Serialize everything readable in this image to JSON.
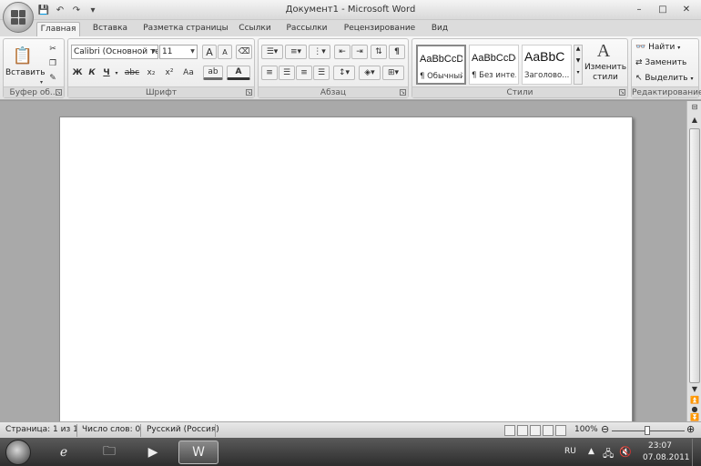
{
  "window": {
    "title": "Документ1 - Microsoft Word",
    "controls": {
      "minimize": "–",
      "maximize": "□",
      "close": "✕"
    }
  },
  "quick_access": {
    "save_icon": "floppy-icon",
    "undo_icon": "undo-icon",
    "redo_icon": "redo-icon"
  },
  "tabs": [
    {
      "label": "Главная",
      "active": true
    },
    {
      "label": "Вставка"
    },
    {
      "label": "Разметка страницы"
    },
    {
      "label": "Ссылки"
    },
    {
      "label": "Рассылки"
    },
    {
      "label": "Рецензирование"
    },
    {
      "label": "Вид"
    }
  ],
  "ribbon": {
    "clipboard": {
      "label": "Буфер об...",
      "paste_label": "Вставить"
    },
    "font": {
      "label": "Шрифт",
      "font_name": "Calibri (Основной те",
      "font_size": "11",
      "grow": "A",
      "shrink": "A",
      "bold": "Ж",
      "italic": "К",
      "underline": "Ч",
      "strike": "abc",
      "subscript": "x₂",
      "superscript": "x²",
      "change_case": "Aa",
      "highlight": "ab",
      "font_color": "A"
    },
    "paragraph": {
      "label": "Абзац",
      "pilcrow": "¶"
    },
    "styles": {
      "label": "Стили",
      "items": [
        {
          "sample": "AaBbCcDc",
          "name": "¶ Обычный"
        },
        {
          "sample": "AaBbCcDc",
          "name": "¶ Без инте..."
        },
        {
          "sample": "AaBbC",
          "name": "Заголово..."
        }
      ],
      "change_styles_line1": "Изменить",
      "change_styles_line2": "стили"
    },
    "editing": {
      "label": "Редактирование",
      "find": "Найти",
      "replace": "Заменить",
      "select": "Выделить"
    }
  },
  "statusbar": {
    "page": "Страница: 1 из 1",
    "words": "Число слов: 0",
    "language": "Русский (Россия)",
    "zoom": "100%"
  },
  "taskbar": {
    "lang": "RU",
    "time": "23:07",
    "date": "07.08.2011"
  },
  "colors": {
    "chrome": "#dcdcdc",
    "page": "#ffffff",
    "taskbar": "#3a3a3a"
  }
}
